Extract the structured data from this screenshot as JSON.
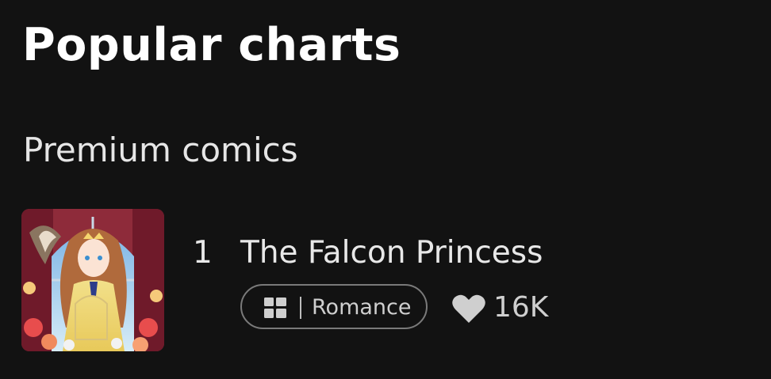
{
  "header": {
    "title": "Popular charts"
  },
  "section": {
    "title": "Premium comics"
  },
  "comics": [
    {
      "rank": "1",
      "title": "The Falcon Princess",
      "genre": "Romance",
      "genre_icon": "layout-grid-icon",
      "likes": "16K",
      "likes_icon": "heart-icon"
    }
  ],
  "colors": {
    "background": "#121212",
    "title_text": "#ffffff",
    "secondary_text": "#cfcfcf",
    "badge_border": "#7a7a7a"
  }
}
